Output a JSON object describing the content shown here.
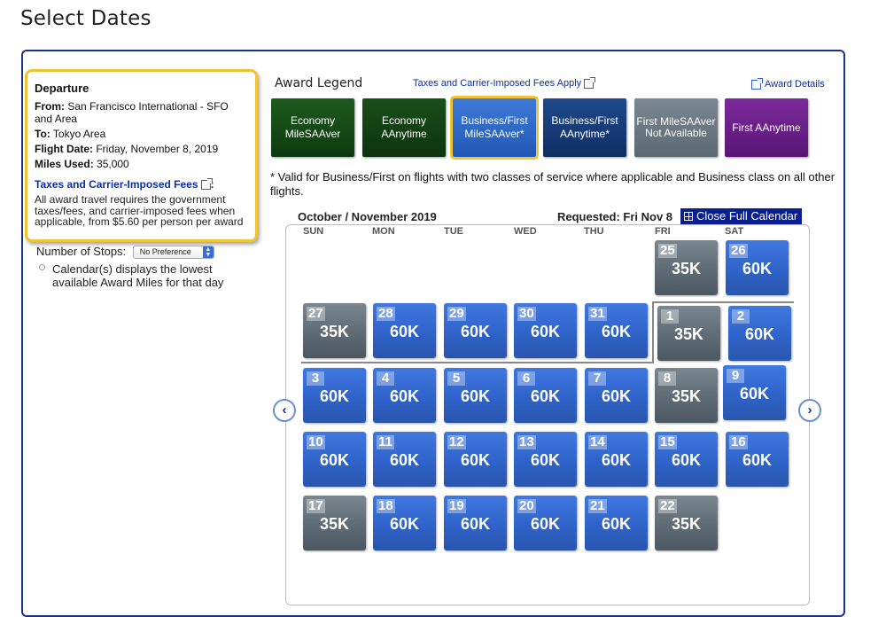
{
  "page_title": "Select Dates",
  "departure": {
    "header": "Departure",
    "from_label": "From:",
    "from_value": "San Francisco International - SFO and Area",
    "to_label": "To:",
    "to_value": "Tokyo Area",
    "flight_date_label": "Flight Date:",
    "flight_date_value": "Friday, November 8, 2019",
    "miles_used_label": "Miles Used:",
    "miles_used_value": "35,000",
    "fees_link": "Taxes and Carrier-Imposed Fees",
    "fees_colon": ":",
    "fees_note": "All award travel requires the government taxes/fees, and carrier-imposed fees when applicable, from $5.60 per person per award"
  },
  "stops": {
    "label": "Number of Stops:",
    "selected": "No Preference"
  },
  "calendar_note": "Calendar(s) displays the lowest available Award Miles for that day",
  "legend": {
    "title": "Award Legend",
    "taxes_link": "Taxes and Carrier-Imposed Fees Apply",
    "award_details": "Award Details",
    "items": [
      {
        "label": "Economy MileSAAver"
      },
      {
        "label": "Economy AAnytime"
      },
      {
        "label": "Business/First MileSAAver*"
      },
      {
        "label": "Business/First AAnytime*"
      },
      {
        "label": "First MileSAAver Not Available"
      },
      {
        "label": "First AAnytime"
      }
    ]
  },
  "footnote": "* Valid for Business/First on flights with two classes of service where applicable and Business class on all other flights.",
  "calendar": {
    "month_label": "October / November 2019",
    "requested": "Requested: Fri Nov 8",
    "close_button": "Close Full Calendar",
    "weekdays": [
      "SUN",
      "MON",
      "TUE",
      "WED",
      "THU",
      "FRI",
      "SAT"
    ],
    "prev_arrow": "‹",
    "next_arrow": "›",
    "days": [
      {
        "day": "25",
        "miles": "35K",
        "type": "gray"
      },
      {
        "day": "26",
        "miles": "60K",
        "type": "blue"
      },
      {
        "day": "27",
        "miles": "35K",
        "type": "gray"
      },
      {
        "day": "28",
        "miles": "60K",
        "type": "blue"
      },
      {
        "day": "29",
        "miles": "60K",
        "type": "blue"
      },
      {
        "day": "30",
        "miles": "60K",
        "type": "blue"
      },
      {
        "day": "31",
        "miles": "60K",
        "type": "blue"
      },
      {
        "day": "1",
        "miles": "35K",
        "type": "gray"
      },
      {
        "day": "2",
        "miles": "60K",
        "type": "blue"
      },
      {
        "day": "3",
        "miles": "60K",
        "type": "blue"
      },
      {
        "day": "4",
        "miles": "60K",
        "type": "blue"
      },
      {
        "day": "5",
        "miles": "60K",
        "type": "blue"
      },
      {
        "day": "6",
        "miles": "60K",
        "type": "blue"
      },
      {
        "day": "7",
        "miles": "60K",
        "type": "blue"
      },
      {
        "day": "8",
        "miles": "35K",
        "type": "gray"
      },
      {
        "day": "9",
        "miles": "60K",
        "type": "blue"
      },
      {
        "day": "10",
        "miles": "60K",
        "type": "blue"
      },
      {
        "day": "11",
        "miles": "60K",
        "type": "blue"
      },
      {
        "day": "12",
        "miles": "60K",
        "type": "blue"
      },
      {
        "day": "13",
        "miles": "60K",
        "type": "blue"
      },
      {
        "day": "14",
        "miles": "60K",
        "type": "blue"
      },
      {
        "day": "15",
        "miles": "60K",
        "type": "blue"
      },
      {
        "day": "16",
        "miles": "60K",
        "type": "blue"
      },
      {
        "day": "17",
        "miles": "35K",
        "type": "gray"
      },
      {
        "day": "18",
        "miles": "60K",
        "type": "blue"
      },
      {
        "day": "19",
        "miles": "60K",
        "type": "blue"
      },
      {
        "day": "20",
        "miles": "60K",
        "type": "blue"
      },
      {
        "day": "21",
        "miles": "60K",
        "type": "blue"
      },
      {
        "day": "22",
        "miles": "35K",
        "type": "gray"
      }
    ]
  }
}
